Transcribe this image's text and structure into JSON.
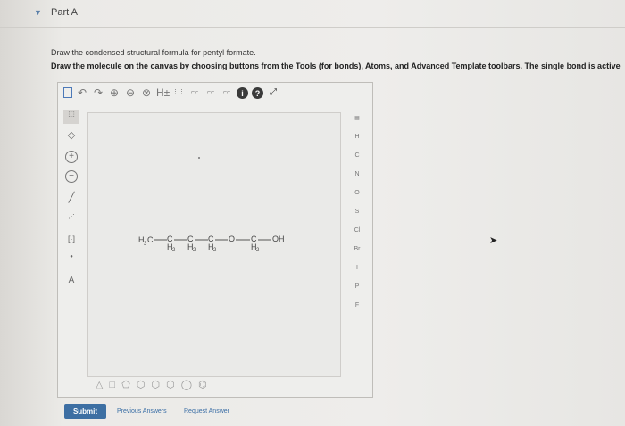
{
  "part": {
    "title": "Part A"
  },
  "question": {
    "line1": "Draw the condensed structural formula for pentyl formate.",
    "line2": "Draw the molecule on the canvas by choosing buttons from the Tools (for bonds), Atoms, and Advanced Template toolbars. The single bond is active"
  },
  "toolbar": {
    "new": "new-doc-icon",
    "undo": "↶",
    "redo": "↷",
    "zoom_in": "⊕",
    "zoom_out": "⊖",
    "reset": "⊗",
    "hydrogens": "H±",
    "info": "i",
    "help": "?"
  },
  "right_atoms": [
    "H",
    "C",
    "N",
    "O",
    "S",
    "Cl",
    "Br",
    "I",
    "P",
    "F"
  ],
  "molecule": {
    "start": "H",
    "start_sub": "3",
    "carbon": "C",
    "oxygen": "O",
    "hydroxyl": "OH",
    "h2": "H",
    "h2_sub": "2"
  },
  "shapes_row": "△ □ ⬠ ⬡ ⬡ ⬡ ◯ ⌬",
  "buttons": {
    "submit": "Submit",
    "previous_answers": "Previous Answers",
    "request_answer": "Request Answer"
  }
}
